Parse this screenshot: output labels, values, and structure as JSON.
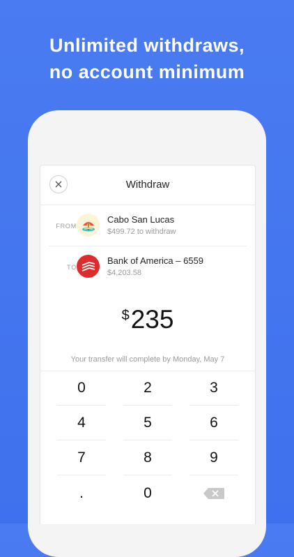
{
  "headline": {
    "line1": "Unlimited withdraws,",
    "line2": "no account minimum"
  },
  "modal": {
    "title": "Withdraw",
    "close_icon": "close-icon"
  },
  "from": {
    "tag": "FROM",
    "icon": "beach-umbrella-icon",
    "name": "Cabo San Lucas",
    "detail": "$499.72 to withdraw"
  },
  "to": {
    "tag": "TO",
    "icon": "bank-of-america-logo-icon",
    "name": "Bank of America – 6559",
    "detail": "$4,203.58"
  },
  "amount": {
    "currency": "$",
    "value": "235"
  },
  "transfer_note": "Your transfer will complete by Monday, May 7",
  "keypad": {
    "keys": [
      "0",
      "2",
      "3",
      "4",
      "5",
      "6",
      "7",
      "8",
      "9",
      ".",
      "0"
    ],
    "backspace_icon": "backspace-icon"
  },
  "colors": {
    "background": "#4a7bf0",
    "bank_red": "#de2c2c",
    "beach_bg": "#fbf4d6"
  }
}
